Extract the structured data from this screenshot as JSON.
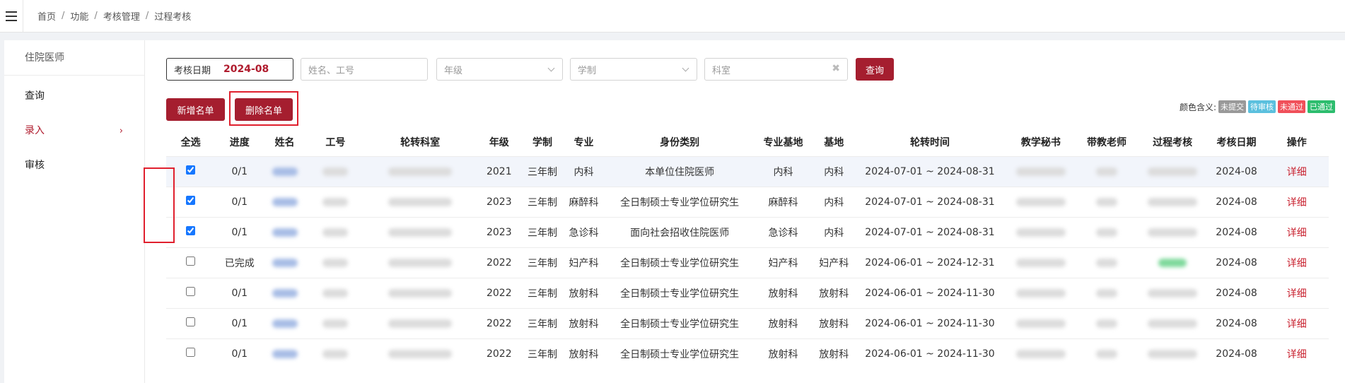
{
  "breadcrumb": [
    "首页",
    "功能",
    "考核管理",
    "过程考核"
  ],
  "sidebar": {
    "title": "住院医师",
    "items": [
      {
        "label": "查询"
      },
      {
        "label": "录入",
        "chevron": "›"
      },
      {
        "label": "审核"
      }
    ]
  },
  "filters": {
    "date_label": "考核日期",
    "date_value": "2024-08",
    "name_placeholder": "姓名、工号",
    "grade_placeholder": "年级",
    "system_placeholder": "学制",
    "dept_placeholder": "科室",
    "clear_glyph": "✖",
    "query_label": "查询"
  },
  "actions": {
    "add_label": "新增名单",
    "delete_label": "删除名单"
  },
  "legend": {
    "label": "颜色含义:",
    "tags": [
      {
        "text": "未提交",
        "color": "#999999"
      },
      {
        "text": "待审核",
        "color": "#5bc0de"
      },
      {
        "text": "未通过",
        "color": "#f0505a"
      },
      {
        "text": "已通过",
        "color": "#2dbd6e"
      }
    ]
  },
  "table": {
    "headers": [
      "全选",
      "进度",
      "姓名",
      "工号",
      "轮转科室",
      "年级",
      "学制",
      "专业",
      "身份类别",
      "专业基地",
      "基地",
      "轮转时间",
      "教学秘书",
      "带教老师",
      "过程考核",
      "考核日期",
      "操作"
    ],
    "rows": [
      {
        "checked": true,
        "progress": "0/1",
        "grade": "2021",
        "system": "三年制",
        "major": "内科",
        "identity": "本单位住院医师",
        "major_base": "内科",
        "base": "内科",
        "rotation": "2024-07-01 ~ 2024-08-31",
        "date": "2024-08",
        "op": "详细",
        "passed": false
      },
      {
        "checked": true,
        "progress": "0/1",
        "grade": "2023",
        "system": "三年制",
        "major": "麻醉科",
        "identity": "全日制硕士专业学位研究生",
        "major_base": "麻醉科",
        "base": "内科",
        "rotation": "2024-07-01 ~ 2024-08-31",
        "date": "2024-08",
        "op": "详细",
        "passed": false
      },
      {
        "checked": true,
        "progress": "0/1",
        "grade": "2023",
        "system": "三年制",
        "major": "急诊科",
        "identity": "面向社会招收住院医师",
        "major_base": "急诊科",
        "base": "内科",
        "rotation": "2024-07-01 ~ 2024-08-31",
        "date": "2024-08",
        "op": "详细",
        "passed": false
      },
      {
        "checked": false,
        "progress": "已完成",
        "grade": "2022",
        "system": "三年制",
        "major": "妇产科",
        "identity": "全日制硕士专业学位研究生",
        "major_base": "妇产科",
        "base": "妇产科",
        "rotation": "2024-06-01 ~ 2024-12-31",
        "date": "2024-08",
        "op": "详细",
        "passed": true
      },
      {
        "checked": false,
        "progress": "0/1",
        "grade": "2022",
        "system": "三年制",
        "major": "放射科",
        "identity": "全日制硕士专业学位研究生",
        "major_base": "放射科",
        "base": "放射科",
        "rotation": "2024-06-01 ~ 2024-11-30",
        "date": "2024-08",
        "op": "详细",
        "passed": false
      },
      {
        "checked": false,
        "progress": "0/1",
        "grade": "2022",
        "system": "三年制",
        "major": "放射科",
        "identity": "全日制硕士专业学位研究生",
        "major_base": "放射科",
        "base": "放射科",
        "rotation": "2024-06-01 ~ 2024-11-30",
        "date": "2024-08",
        "op": "详细",
        "passed": false
      },
      {
        "checked": false,
        "progress": "0/1",
        "grade": "2022",
        "system": "三年制",
        "major": "放射科",
        "identity": "全日制硕士专业学位研究生",
        "major_base": "放射科",
        "base": "放射科",
        "rotation": "2024-06-01 ~ 2024-11-30",
        "date": "2024-08",
        "op": "详细",
        "passed": false
      }
    ]
  }
}
